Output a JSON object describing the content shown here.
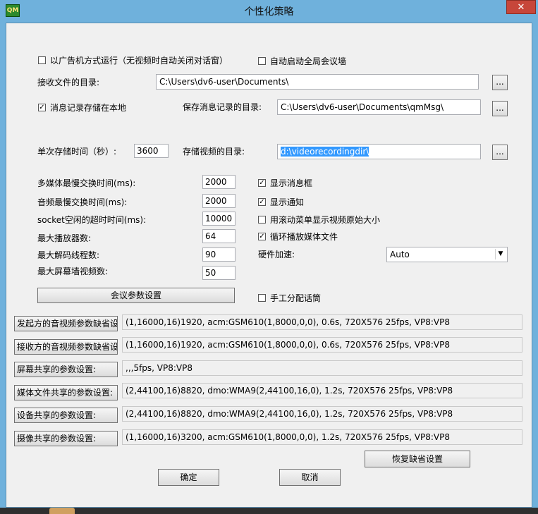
{
  "window": {
    "title": "个性化策略",
    "close": "✕",
    "app_icon": "app-logo-icon"
  },
  "options": {
    "ad_mode": {
      "label": "以广告机方式运行（无视频时自动关闭对话窗）",
      "checked": false
    },
    "auto_wall": {
      "label": "自动启动全局会议墙",
      "checked": false
    }
  },
  "receive_dir": {
    "label": "接收文件的目录:",
    "value": "C:\\Users\\dv6-user\\Documents\\",
    "browse": "..."
  },
  "local_msg": {
    "label": "消息记录存储在本地",
    "checked": true
  },
  "msg_dir": {
    "label": "保存消息记录的目录:",
    "value": "C:\\Users\\dv6-user\\Documents\\qmMsg\\",
    "browse": "..."
  },
  "storage_time": {
    "label": "单次存储时间（秒）:",
    "value": "3600"
  },
  "video_dir": {
    "label": "存储视频的目录:",
    "value": "d:\\videorecordingdir\\",
    "browse": "..."
  },
  "params": [
    {
      "label": "多媒体最慢交换时间(ms):",
      "value": "2000"
    },
    {
      "label": "音频最慢交换时间(ms):",
      "value": "2000"
    },
    {
      "label": "socket空闲的超时时间(ms):",
      "value": "10000"
    },
    {
      "label": "最大播放器数:",
      "value": "64"
    },
    {
      "label": "最大解码线程数:",
      "value": "90"
    },
    {
      "label": "最大屏幕墙视频数:",
      "value": "50"
    }
  ],
  "right_checks": [
    {
      "label": "显示消息框",
      "checked": true
    },
    {
      "label": "显示通知",
      "checked": true
    },
    {
      "label": "用滚动菜单显示视频原始大小",
      "checked": false
    },
    {
      "label": "循环播放媒体文件",
      "checked": true
    }
  ],
  "hw_accel": {
    "label": "硬件加速:",
    "value": "Auto"
  },
  "meeting_btn": "会议参数设置",
  "manual_talk": {
    "label": "手工分配话筒",
    "checked": false
  },
  "av_rows": [
    {
      "button": "发起方的音视频参数缺省设",
      "value": "(1,16000,16)1920, acm:GSM610(1,8000,0,0), 0.6s, 720X576 25fps, VP8:VP8"
    },
    {
      "button": "接收方的音视频参数缺省设",
      "value": "(1,16000,16)1920, acm:GSM610(1,8000,0,0), 0.6s, 720X576 25fps, VP8:VP8"
    },
    {
      "button": "屏幕共享的参数设置:",
      "value": ",,,5fps, VP8:VP8"
    },
    {
      "button": "媒体文件共享的参数设置:",
      "value": "(2,44100,16)8820, dmo:WMA9(2,44100,16,0), 1.2s, 720X576 25fps, VP8:VP8"
    },
    {
      "button": "设备共享的参数设置:",
      "value": "(2,44100,16)8820, dmo:WMA9(2,44100,16,0), 1.2s, 720X576 25fps, VP8:VP8"
    },
    {
      "button": "摄像共享的参数设置:",
      "value": "(1,16000,16)3200, acm:GSM610(1,8000,0,0), 1.2s, 720X576 25fps, VP8:VP8"
    }
  ],
  "restore_btn": "恢复缺省设置",
  "ok_btn": "确定",
  "cancel_btn": "取消"
}
